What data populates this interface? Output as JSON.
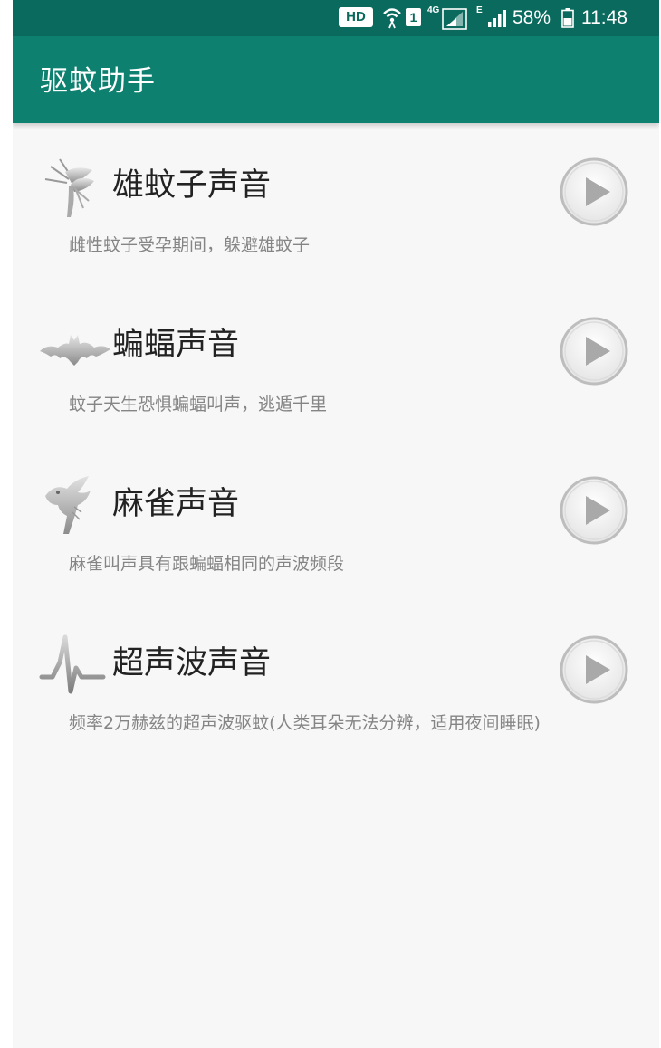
{
  "status_bar": {
    "hd_badge": "HD",
    "sim_slot": "1",
    "network_type": "4G",
    "network_type_2": "E",
    "battery": "58%",
    "time": "11:48"
  },
  "app_bar": {
    "title": "驱蚊助手"
  },
  "colors": {
    "status_bar": "#0b6a5e",
    "app_bar": "#0e8070",
    "background": "#f7f7f7",
    "title_text": "#222222",
    "desc_text": "#858585"
  },
  "sounds": [
    {
      "icon": "mosquito-icon",
      "title": "雄蚊子声音",
      "description": "雌性蚊子受孕期间，躲避雄蚊子",
      "action_icon": "play-icon"
    },
    {
      "icon": "bat-icon",
      "title": "蝙蝠声音",
      "description": "蚊子天生恐惧蝙蝠叫声，逃遁千里",
      "action_icon": "play-icon"
    },
    {
      "icon": "sparrow-icon",
      "title": "麻雀声音",
      "description": "麻雀叫声具有跟蝙蝠相同的声波频段",
      "action_icon": "play-icon"
    },
    {
      "icon": "ultrasonic-wave-icon",
      "title": "超声波声音",
      "description": "频率2万赫兹的超声波驱蚊(人类耳朵无法分辨，适用夜间睡眠)",
      "action_icon": "play-icon"
    }
  ]
}
